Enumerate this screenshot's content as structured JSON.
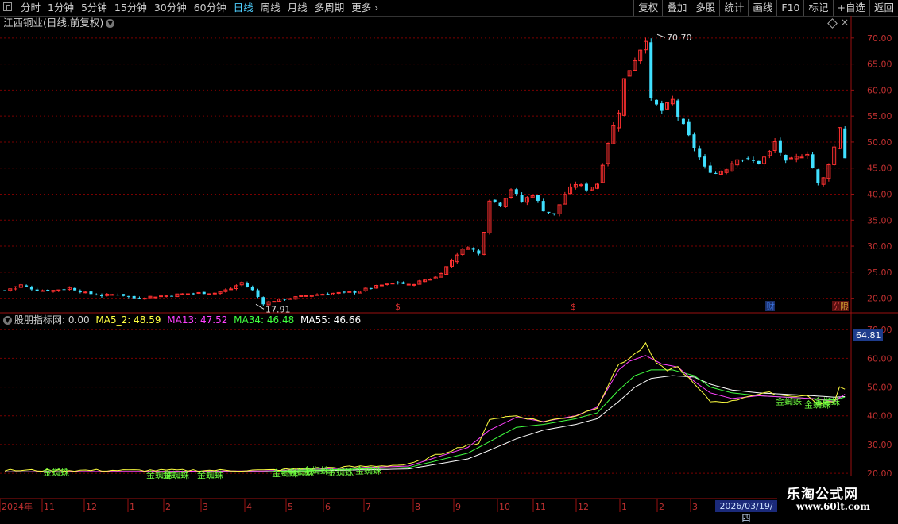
{
  "toolbar": {
    "periods": [
      "分时",
      "1分钟",
      "5分钟",
      "15分钟",
      "30分钟",
      "60分钟",
      "日线",
      "周线",
      "月线",
      "多周期",
      "更多"
    ],
    "active_period": "日线",
    "right_buttons": [
      "复权",
      "叠加",
      "多股",
      "统计",
      "画线",
      "F10",
      "标记",
      "+自选",
      "返回"
    ]
  },
  "main_chart": {
    "title": "江西铜业(日线,前复权)",
    "high_marker": "70.70",
    "low_marker": "17.91",
    "price_axis": [
      "70.00",
      "65.00",
      "60.00",
      "55.00",
      "50.00",
      "45.00",
      "40.00",
      "35.00",
      "30.00",
      "25.00",
      "20.00"
    ],
    "event_markers": [
      {
        "label": "$",
        "color": "#e03030"
      },
      {
        "label": "$",
        "color": "#e03030"
      },
      {
        "label": "财",
        "color": "#3a6fd8"
      },
      {
        "label": "分",
        "color": "#d04040"
      },
      {
        "label": "限",
        "color": "#d0a030"
      }
    ]
  },
  "indicator": {
    "name": "股朋指标网",
    "value": ": 0.00",
    "ma_labels": [
      {
        "text": "MA5_2: 48.59",
        "color": "#ffff40"
      },
      {
        "text": "MA13: 47.52",
        "color": "#ff40ff"
      },
      {
        "text": "MA34: 46.48",
        "color": "#40ff40"
      },
      {
        "text": "MA55: 46.66",
        "color": "#ffffff"
      }
    ],
    "axis": [
      "70.00",
      "60.00",
      "50.00",
      "40.00",
      "30.00",
      "20.00"
    ],
    "current_price": "64.81",
    "signal_label": "金蜘蛛"
  },
  "date_axis": {
    "labels": [
      "2024年",
      "11",
      "12",
      "1",
      "2",
      "3",
      "4",
      "5",
      "6",
      "7",
      "8",
      "9",
      "10",
      "11",
      "12",
      "1",
      "2",
      "3"
    ],
    "cursor_date": "2026/03/19/四"
  },
  "watermark": {
    "name": "乐淘公式网",
    "url": "www.60lt.com"
  },
  "colors": {
    "up": "#ff3030",
    "down": "#40e0ff",
    "grid": "#7a0000",
    "axis_text": "#c03030",
    "yellow": "#ffff40",
    "magenta": "#ff40ff",
    "green": "#40ff40",
    "white": "#ffffff"
  },
  "chart_data": {
    "type": "candlestick",
    "price_range": [
      17.5,
      71.5
    ],
    "indicator_range": [
      12,
      72
    ],
    "close_path": [
      [
        0,
        21.5
      ],
      [
        3,
        22.5
      ],
      [
        6,
        21.5
      ],
      [
        9,
        21.5
      ],
      [
        12,
        22
      ],
      [
        15,
        21
      ],
      [
        18,
        20.5
      ],
      [
        21,
        20.8
      ],
      [
        24,
        20
      ],
      [
        27,
        20.3
      ],
      [
        30,
        20.5
      ],
      [
        33,
        20.8
      ],
      [
        36,
        21
      ],
      [
        39,
        21
      ],
      [
        42,
        21.8
      ],
      [
        44,
        23
      ],
      [
        46,
        21.5
      ],
      [
        48,
        19
      ],
      [
        50,
        19.5
      ],
      [
        53,
        20
      ],
      [
        56,
        20.5
      ],
      [
        59,
        20.8
      ],
      [
        62,
        21
      ],
      [
        65,
        21.2
      ],
      [
        68,
        22
      ],
      [
        70,
        22.5
      ],
      [
        73,
        23
      ],
      [
        75,
        22.5
      ],
      [
        78,
        23.5
      ],
      [
        80,
        24
      ],
      [
        82,
        26
      ],
      [
        84,
        28.5
      ],
      [
        86,
        30
      ],
      [
        88,
        28.5
      ],
      [
        89,
        33
      ],
      [
        90,
        39
      ],
      [
        92,
        38
      ],
      [
        94,
        41
      ],
      [
        96,
        38.5
      ],
      [
        98,
        40
      ],
      [
        100,
        37
      ],
      [
        102,
        36
      ],
      [
        104,
        40
      ],
      [
        106,
        42
      ],
      [
        108,
        41
      ],
      [
        110,
        42
      ],
      [
        112,
        50
      ],
      [
        114,
        56
      ],
      [
        115,
        62
      ],
      [
        117,
        66
      ],
      [
        118,
        68
      ],
      [
        119,
        70
      ],
      [
        120,
        58
      ],
      [
        122,
        56
      ],
      [
        124,
        58
      ],
      [
        125,
        55
      ],
      [
        126,
        53
      ],
      [
        128,
        49
      ],
      [
        130,
        45
      ],
      [
        132,
        44
      ],
      [
        134,
        45
      ],
      [
        136,
        47
      ],
      [
        138,
        46.5
      ],
      [
        140,
        46
      ],
      [
        142,
        48
      ],
      [
        143,
        50
      ],
      [
        145,
        46
      ],
      [
        147,
        47
      ],
      [
        149,
        48
      ],
      [
        150,
        45
      ],
      [
        151,
        42
      ],
      [
        152,
        43
      ],
      [
        154,
        49
      ],
      [
        155,
        53
      ],
      [
        156,
        47
      ]
    ],
    "ma_paths": {
      "MA5_2": [
        [
          0,
          21
        ],
        [
          48,
          21
        ],
        [
          75,
          23
        ],
        [
          86,
          30
        ],
        [
          88,
          30
        ],
        [
          90,
          39
        ],
        [
          95,
          40
        ],
        [
          100,
          38
        ],
        [
          106,
          40
        ],
        [
          110,
          43
        ],
        [
          114,
          58
        ],
        [
          116,
          60
        ],
        [
          118,
          63
        ],
        [
          119,
          65
        ],
        [
          121,
          58
        ],
        [
          123,
          56
        ],
        [
          125,
          57
        ],
        [
          128,
          51
        ],
        [
          131,
          45
        ],
        [
          135,
          45
        ],
        [
          138,
          47
        ],
        [
          142,
          48
        ],
        [
          145,
          47
        ],
        [
          149,
          47
        ],
        [
          151,
          44
        ],
        [
          154,
          45
        ],
        [
          155,
          50
        ],
        [
          156,
          49
        ]
      ],
      "MA13": [
        [
          0,
          20.5
        ],
        [
          48,
          20.8
        ],
        [
          75,
          22.5
        ],
        [
          86,
          29
        ],
        [
          90,
          35
        ],
        [
          95,
          39.5
        ],
        [
          100,
          38
        ],
        [
          106,
          40
        ],
        [
          110,
          43
        ],
        [
          114,
          56
        ],
        [
          116,
          59
        ],
        [
          119,
          61
        ],
        [
          122,
          58
        ],
        [
          125,
          57
        ],
        [
          128,
          52
        ],
        [
          131,
          48
        ],
        [
          135,
          46
        ],
        [
          140,
          47
        ],
        [
          145,
          46.5
        ],
        [
          150,
          46
        ],
        [
          154,
          45
        ],
        [
          156,
          47.5
        ]
      ],
      "MA34": [
        [
          0,
          20.5
        ],
        [
          48,
          20.5
        ],
        [
          75,
          22
        ],
        [
          86,
          27
        ],
        [
          90,
          31
        ],
        [
          95,
          36
        ],
        [
          100,
          37
        ],
        [
          106,
          39
        ],
        [
          110,
          41
        ],
        [
          114,
          49
        ],
        [
          117,
          54
        ],
        [
          120,
          56
        ],
        [
          124,
          56
        ],
        [
          128,
          54
        ],
        [
          131,
          50
        ],
        [
          135,
          48
        ],
        [
          140,
          47
        ],
        [
          145,
          46.5
        ],
        [
          150,
          46
        ],
        [
          154,
          45.5
        ],
        [
          156,
          46.5
        ]
      ],
      "MA55": [
        [
          0,
          20.5
        ],
        [
          48,
          20.5
        ],
        [
          75,
          21.5
        ],
        [
          86,
          25
        ],
        [
          90,
          28
        ],
        [
          95,
          32
        ],
        [
          100,
          35
        ],
        [
          106,
          37
        ],
        [
          110,
          39
        ],
        [
          114,
          45
        ],
        [
          117,
          50
        ],
        [
          120,
          53
        ],
        [
          124,
          54
        ],
        [
          128,
          53.5
        ],
        [
          131,
          51
        ],
        [
          135,
          49
        ],
        [
          140,
          48
        ],
        [
          145,
          47.5
        ],
        [
          150,
          47
        ],
        [
          154,
          46.5
        ],
        [
          156,
          46.7
        ]
      ]
    }
  }
}
